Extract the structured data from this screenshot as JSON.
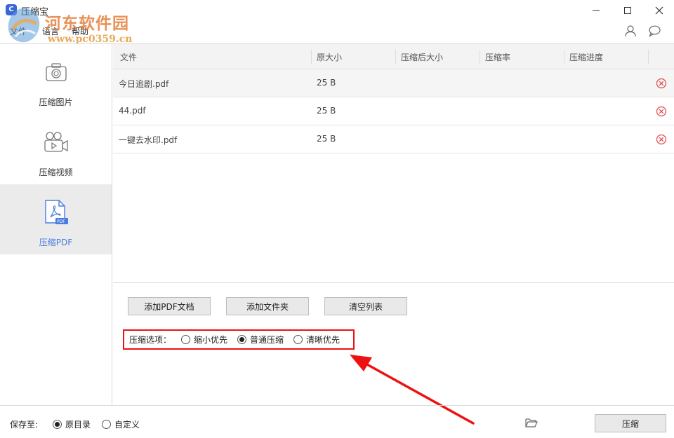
{
  "window": {
    "title": "压缩宝",
    "app_icon_letter": "C"
  },
  "watermark": {
    "title": "河东软件园",
    "url": "www.pc0359.cn"
  },
  "menu": {
    "items": [
      "文件",
      "语言",
      "帮助"
    ]
  },
  "sidebar": {
    "items": [
      {
        "label": "压缩图片",
        "icon": "camera-icon",
        "active": false
      },
      {
        "label": "压缩视频",
        "icon": "video-camera-icon",
        "active": false
      },
      {
        "label": "压缩PDF",
        "icon": "pdf-file-icon",
        "active": true
      }
    ]
  },
  "table": {
    "headers": [
      "文件",
      "原大小",
      "压缩后大小",
      "压缩率",
      "压缩进度"
    ],
    "rows": [
      {
        "file": "今日追剧.pdf",
        "size": "25 B"
      },
      {
        "file": "44.pdf",
        "size": "25 B"
      },
      {
        "file": "一键去水印.pdf",
        "size": "25 B"
      }
    ]
  },
  "buttons": {
    "add_pdf": "添加PDF文档",
    "add_folder": "添加文件夹",
    "clear_list": "清空列表"
  },
  "compression": {
    "label": "压缩选项：",
    "options": [
      {
        "label": "缩小优先",
        "selected": false
      },
      {
        "label": "普通压缩",
        "selected": true
      },
      {
        "label": "清晰优先",
        "selected": false
      }
    ]
  },
  "footer": {
    "save_label": "保存至:",
    "save_options": [
      {
        "label": "原目录",
        "selected": true
      },
      {
        "label": "自定义",
        "selected": false
      }
    ],
    "compress_label": "压缩"
  },
  "colors": {
    "accent": "#4a7ce0",
    "highlight_border": "#e11111",
    "delete_icon": "#e04545"
  }
}
